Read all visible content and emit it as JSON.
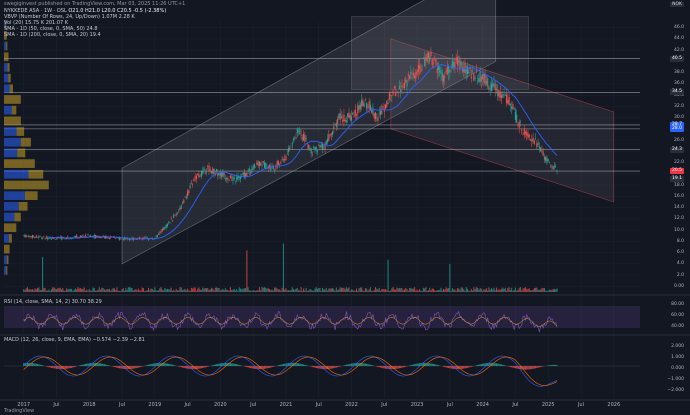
{
  "header": {
    "published": "swegiginvest published on TradingView.com, Mar 03, 2025 11:26 UTC+1",
    "symbol_line": "NYKKEDE ASA · 1W · OSL",
    "ohlc": "O21.0 H21.0 L20.0 C20.5 -0.5 (-2.38%)",
    "vbvp": "VBVP (Number Of Rows, 24, Up/Down) 1.07M 2.28 K",
    "vol": "Vol (20) 15.75 K 201.07 K",
    "sma1": "SMA - 1D (50, close, 0, SMA, 50) 24.8",
    "sma2": "SMA - 1D (200, close, 0, SMA, 20) 19.4",
    "currency": "NOK"
  },
  "price_axis": [
    "46.0",
    "44.0",
    "42.0",
    "40.0",
    "38.0",
    "36.0",
    "34.0",
    "32.0",
    "30.0",
    "28.0",
    "26.0",
    "24.0",
    "22.0",
    "20.0",
    "18.0",
    "16.0",
    "14.0",
    "12.0",
    "10.0",
    "8.0",
    "6.0",
    "4.0",
    "2.0",
    "0.00"
  ],
  "badges": [
    {
      "label": "40.5",
      "color": "#2a2e39",
      "price": 40.5
    },
    {
      "label": "34.5",
      "color": "#2a2e39",
      "price": 34.5
    },
    {
      "label": "28.7",
      "color": "#2962ff",
      "price": 28.7
    },
    {
      "label": "28.0",
      "color": "#2962ff",
      "price": 28.0
    },
    {
      "label": "24.3",
      "color": "#2a2e39",
      "price": 24.3
    },
    {
      "label": "20.5",
      "color": "#f23645",
      "price": 20.5
    },
    {
      "label": "19.1",
      "color": "#2a2e39",
      "price": 19.1
    }
  ],
  "rsi": {
    "label": "RSI (14, close, SMA, 14, 2) 30.70 38.29",
    "axis": [
      "80.00",
      "60.00",
      "40.00"
    ]
  },
  "macd": {
    "label": "MACD (12, 26, close, 9, EMA, EMA) −0.574 −2.39 −2.81",
    "axis": [
      "2.000",
      "1.000",
      "0.000",
      "−1.000",
      "−2.000"
    ]
  },
  "time_axis": [
    {
      "label": "2017",
      "year": 2017
    },
    {
      "label": "Jul",
      "year": 2017.5
    },
    {
      "label": "2018",
      "year": 2018
    },
    {
      "label": "Jul",
      "year": 2018.5
    },
    {
      "label": "2019",
      "year": 2019
    },
    {
      "label": "Jul",
      "year": 2019.5
    },
    {
      "label": "2020",
      "year": 2020
    },
    {
      "label": "Jul",
      "year": 2020.5
    },
    {
      "label": "2021",
      "year": 2021
    },
    {
      "label": "Jul",
      "year": 2021.5
    },
    {
      "label": "2022",
      "year": 2022
    },
    {
      "label": "Jul",
      "year": 2022.5
    },
    {
      "label": "2023",
      "year": 2023
    },
    {
      "label": "Jul",
      "year": 2023.5
    },
    {
      "label": "2024",
      "year": 2024
    },
    {
      "label": "Jul",
      "year": 2024.5
    },
    {
      "label": "2025",
      "year": 2025
    },
    {
      "label": "Jul",
      "year": 2025.5
    },
    {
      "label": "2026",
      "year": 2026
    }
  ],
  "logo": "TradingView",
  "colors": {
    "up": "#26a69a",
    "down": "#ef5350",
    "sma": "#2962ff",
    "rsi": "#7e57c2",
    "hline": "#b2b5be"
  },
  "chart_data": {
    "type": "candlestick",
    "price_series": [
      [
        2017.0,
        9
      ],
      [
        2017.5,
        8.5
      ],
      [
        2018.0,
        9
      ],
      [
        2018.5,
        8.5
      ],
      [
        2019.0,
        8.5
      ],
      [
        2019.2,
        11
      ],
      [
        2019.4,
        14
      ],
      [
        2019.6,
        19
      ],
      [
        2019.8,
        21
      ],
      [
        2020.0,
        20
      ],
      [
        2020.2,
        19
      ],
      [
        2020.4,
        20
      ],
      [
        2020.6,
        22
      ],
      [
        2020.8,
        21
      ],
      [
        2021.0,
        23
      ],
      [
        2021.2,
        28
      ],
      [
        2021.4,
        24
      ],
      [
        2021.6,
        25
      ],
      [
        2021.8,
        30
      ],
      [
        2022.0,
        30
      ],
      [
        2022.2,
        33
      ],
      [
        2022.4,
        30
      ],
      [
        2022.6,
        34
      ],
      [
        2022.8,
        36
      ],
      [
        2023.0,
        38
      ],
      [
        2023.2,
        41
      ],
      [
        2023.4,
        37
      ],
      [
        2023.6,
        40
      ],
      [
        2023.8,
        38
      ],
      [
        2024.0,
        37
      ],
      [
        2024.2,
        35
      ],
      [
        2024.4,
        33
      ],
      [
        2024.6,
        28
      ],
      [
        2024.8,
        26
      ],
      [
        2025.0,
        22
      ],
      [
        2025.15,
        20.5
      ]
    ],
    "horizontal_levels": [
      40.5,
      34.5,
      28.7,
      28.0,
      24.3,
      20.5
    ],
    "rsi_levels": [
      80,
      60,
      40
    ],
    "ylim": [
      0,
      47
    ]
  }
}
